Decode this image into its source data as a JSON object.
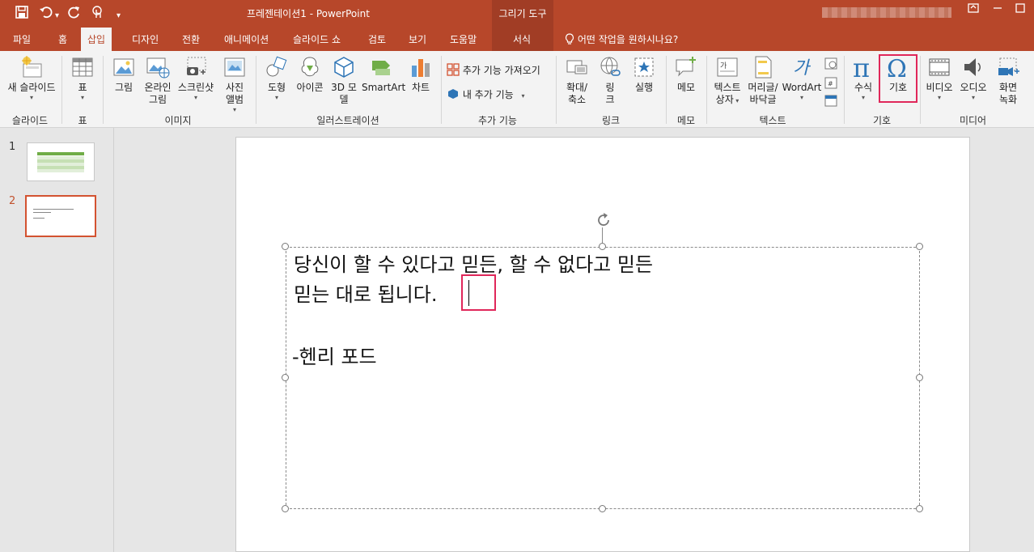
{
  "app": {
    "title": "프레젠테이션1  -  PowerPoint",
    "contextual_tab_title": "그리기 도구",
    "accent": "#b7472a"
  },
  "qat": {
    "save_icon": "save-icon",
    "undo_icon": "undo-icon",
    "undo_dropdown": "▾",
    "redo_icon": "redo-icon",
    "touch_icon": "touch-mode-icon",
    "customize": "▾"
  },
  "tabs": [
    "파일",
    "홈",
    "삽입",
    "디자인",
    "전환",
    "애니메이션",
    "슬라이드 쇼",
    "검토",
    "보기",
    "도움말",
    "서식"
  ],
  "active_tab": "삽입",
  "tell_me": "어떤 작업을 원하시나요?",
  "ribbon": {
    "new_slide": "새 슬라이드",
    "table": "표",
    "picture": "그림",
    "online_picture_1": "온라인",
    "online_picture_2": "그림",
    "screenshot": "스크린샷",
    "photo_album_1": "사진",
    "photo_album_2": "앨범",
    "shapes": "도형",
    "icons": "아이콘",
    "model_3d_1": "3D 모",
    "model_3d_2": "델",
    "smartart": "SmartArt",
    "chart": "차트",
    "get_addins": "추가 기능 가져오기",
    "my_addins": "내 추가 기능",
    "zoom_1": "확대/",
    "zoom_2": "축소",
    "link_1": "링",
    "link_2": "크",
    "action": "실행",
    "comment": "메모",
    "textbox_1": "텍스트",
    "textbox_2": "상자",
    "header_footer_1": "머리글/",
    "header_footer_2": "바닥글",
    "wordart": "WordArt",
    "equation": "수식",
    "symbol": "기호",
    "video": "비디오",
    "audio": "오디오",
    "screen_record_1": "화면",
    "screen_record_2": "녹화",
    "arrow": "▾",
    "groups": {
      "slides": "슬라이드",
      "tables": "표",
      "images": "이미지",
      "illustrations": "일러스트레이션",
      "addins": "추가 기능",
      "links": "링크",
      "comments": "메모",
      "text": "텍스트",
      "symbols": "기호",
      "media": "미디어"
    }
  },
  "thumbnails": [
    {
      "number": "1"
    },
    {
      "number": "2"
    }
  ],
  "slide": {
    "line1": "당신이 할 수 있다고 믿든, 할 수 없다고 믿든",
    "line2": "믿는 대로 됩니다.",
    "line3": "-헨리 포드"
  }
}
